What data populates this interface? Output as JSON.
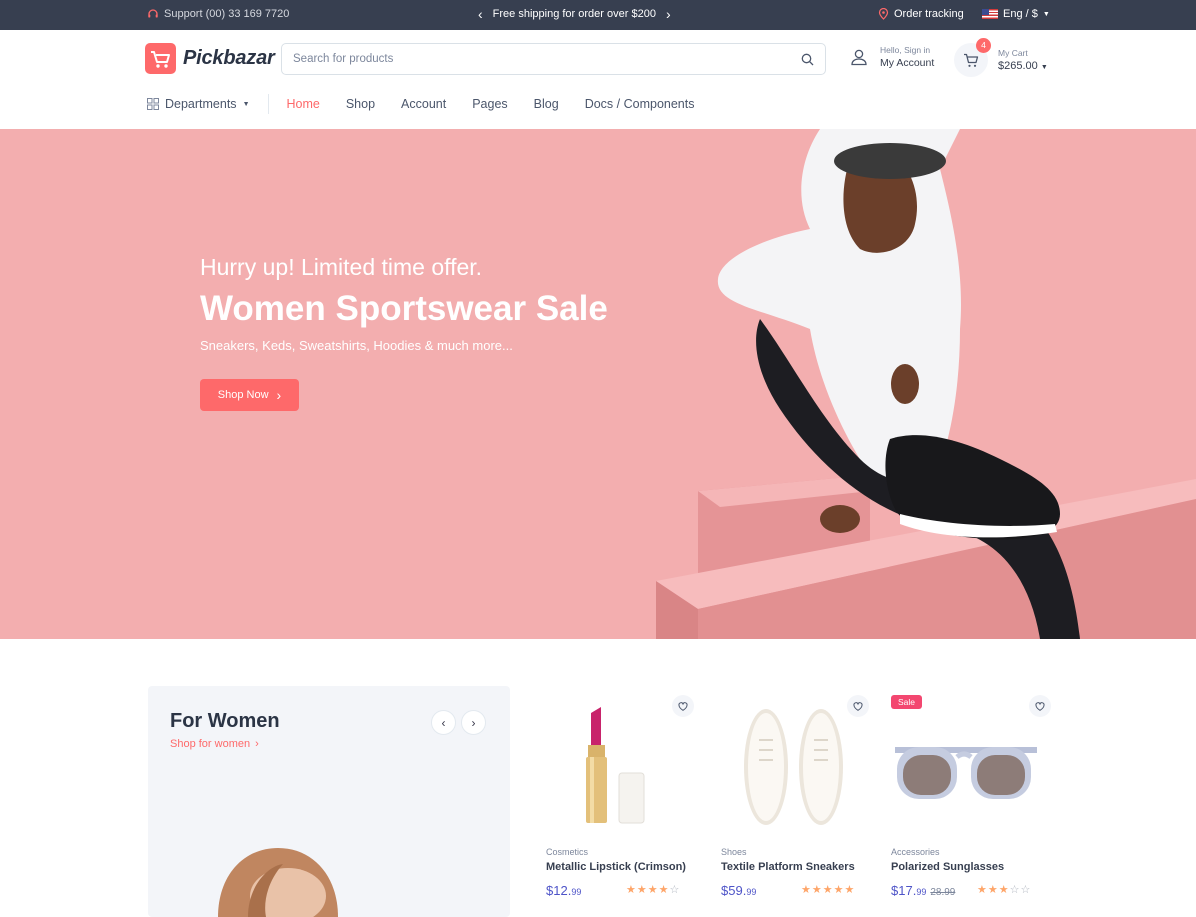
{
  "topbar": {
    "support": "Support (00) 33 169 7720",
    "promo": "Free shipping for order over $200",
    "tracking": "Order tracking",
    "language": "Eng / $"
  },
  "header": {
    "brand": "Pickbazar",
    "search_placeholder": "Search for products",
    "account_hello": "Hello, Sign in",
    "account_label": "My Account",
    "cart_count": "4",
    "cart_label": "My Cart",
    "cart_total": "$265.00"
  },
  "nav": {
    "departments": "Departments",
    "items": [
      "Home",
      "Shop",
      "Account",
      "Pages",
      "Blog",
      "Docs / Components"
    ],
    "active": "Home"
  },
  "hero": {
    "kicker": "Hurry up! Limited time offer.",
    "headline": "Women Sportswear Sale",
    "subtext": "Sneakers, Keds, Sweatshirts, Hoodies & much more...",
    "button": "Shop Now"
  },
  "featured": {
    "title": "For Women",
    "link": "Shop for women"
  },
  "products": [
    {
      "category": "Cosmetics",
      "name": "Metallic Lipstick (Crimson)",
      "price_main": "$12.",
      "price_cents": "99",
      "old_price": "",
      "rating": 4,
      "sale": ""
    },
    {
      "category": "Shoes",
      "name": "Textile Platform Sneakers",
      "price_main": "$59.",
      "price_cents": "99",
      "old_price": "",
      "rating": 5,
      "sale": ""
    },
    {
      "category": "Accessories",
      "name": "Polarized Sunglasses",
      "price_main": "$17.",
      "price_cents": "99",
      "old_price": "28.99",
      "rating": 3,
      "sale": "Sale"
    }
  ],
  "colors": {
    "accent": "#fe696a",
    "topbar": "#373f50",
    "hero_bg": "#f3aeaf",
    "price": "#4e54c8",
    "star": "#fea569"
  }
}
